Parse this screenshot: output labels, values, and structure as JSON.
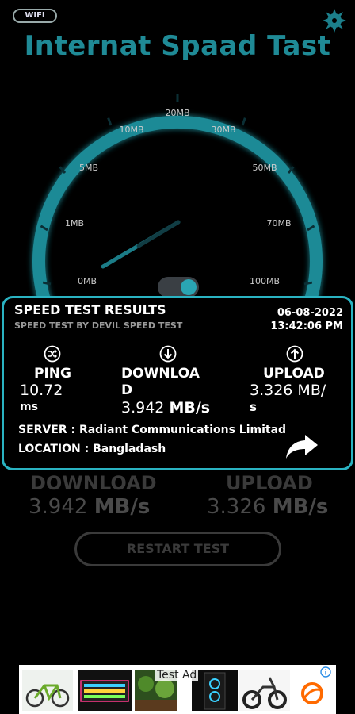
{
  "header": {
    "wifi_badge": "WIFI",
    "title": "Internat Spaad Tast"
  },
  "gauge": {
    "ticks": [
      {
        "label": "0MB",
        "value": 0
      },
      {
        "label": "1MB",
        "value": 1
      },
      {
        "label": "5MB",
        "value": 5
      },
      {
        "label": "10MB",
        "value": 10
      },
      {
        "label": "20MB",
        "value": 20
      },
      {
        "label": "30MB",
        "value": 30
      },
      {
        "label": "50MB",
        "value": 50
      },
      {
        "label": "70MB",
        "value": 70
      },
      {
        "label": "100MB",
        "value": 100
      }
    ],
    "toggle_on": true,
    "colors": {
      "ring": "#1f8a96",
      "glow": "#3fd6e6",
      "needle": "#1f8a96"
    }
  },
  "results": {
    "title": "SPEED TEST RESULTS",
    "subtitle": "SPEED TEST BY DEVIL SPEED TEST",
    "date": "06-08-2022",
    "time": "13:42:06 PM",
    "ping": {
      "label": "PING",
      "value_line1": "10.72",
      "value_line2": "ms",
      "icon": "shuffle-icon"
    },
    "download": {
      "label_line1": "DOWNLOA",
      "label_line2": "D",
      "value_num": "3.942",
      "value_unit": "MB/s",
      "icon": "arrow-down-icon"
    },
    "upload": {
      "label": "UPLOAD",
      "value_line1": "3.326 MB/",
      "value_line2": "s",
      "icon": "arrow-up-icon"
    },
    "server": "SERVER : Radiant Communications Limitad",
    "location": "LOCATION : Bangladash",
    "border_color": "#2ab3c2"
  },
  "summary": {
    "download_label": "DOWNLOAD",
    "download_num": "3.942",
    "download_unit": "MB/s",
    "upload_label": "UPLOAD",
    "upload_num": "3.326",
    "upload_unit": "MB/s"
  },
  "restart_label": "RESTART TEST",
  "ad": {
    "label": "Test Ad"
  }
}
